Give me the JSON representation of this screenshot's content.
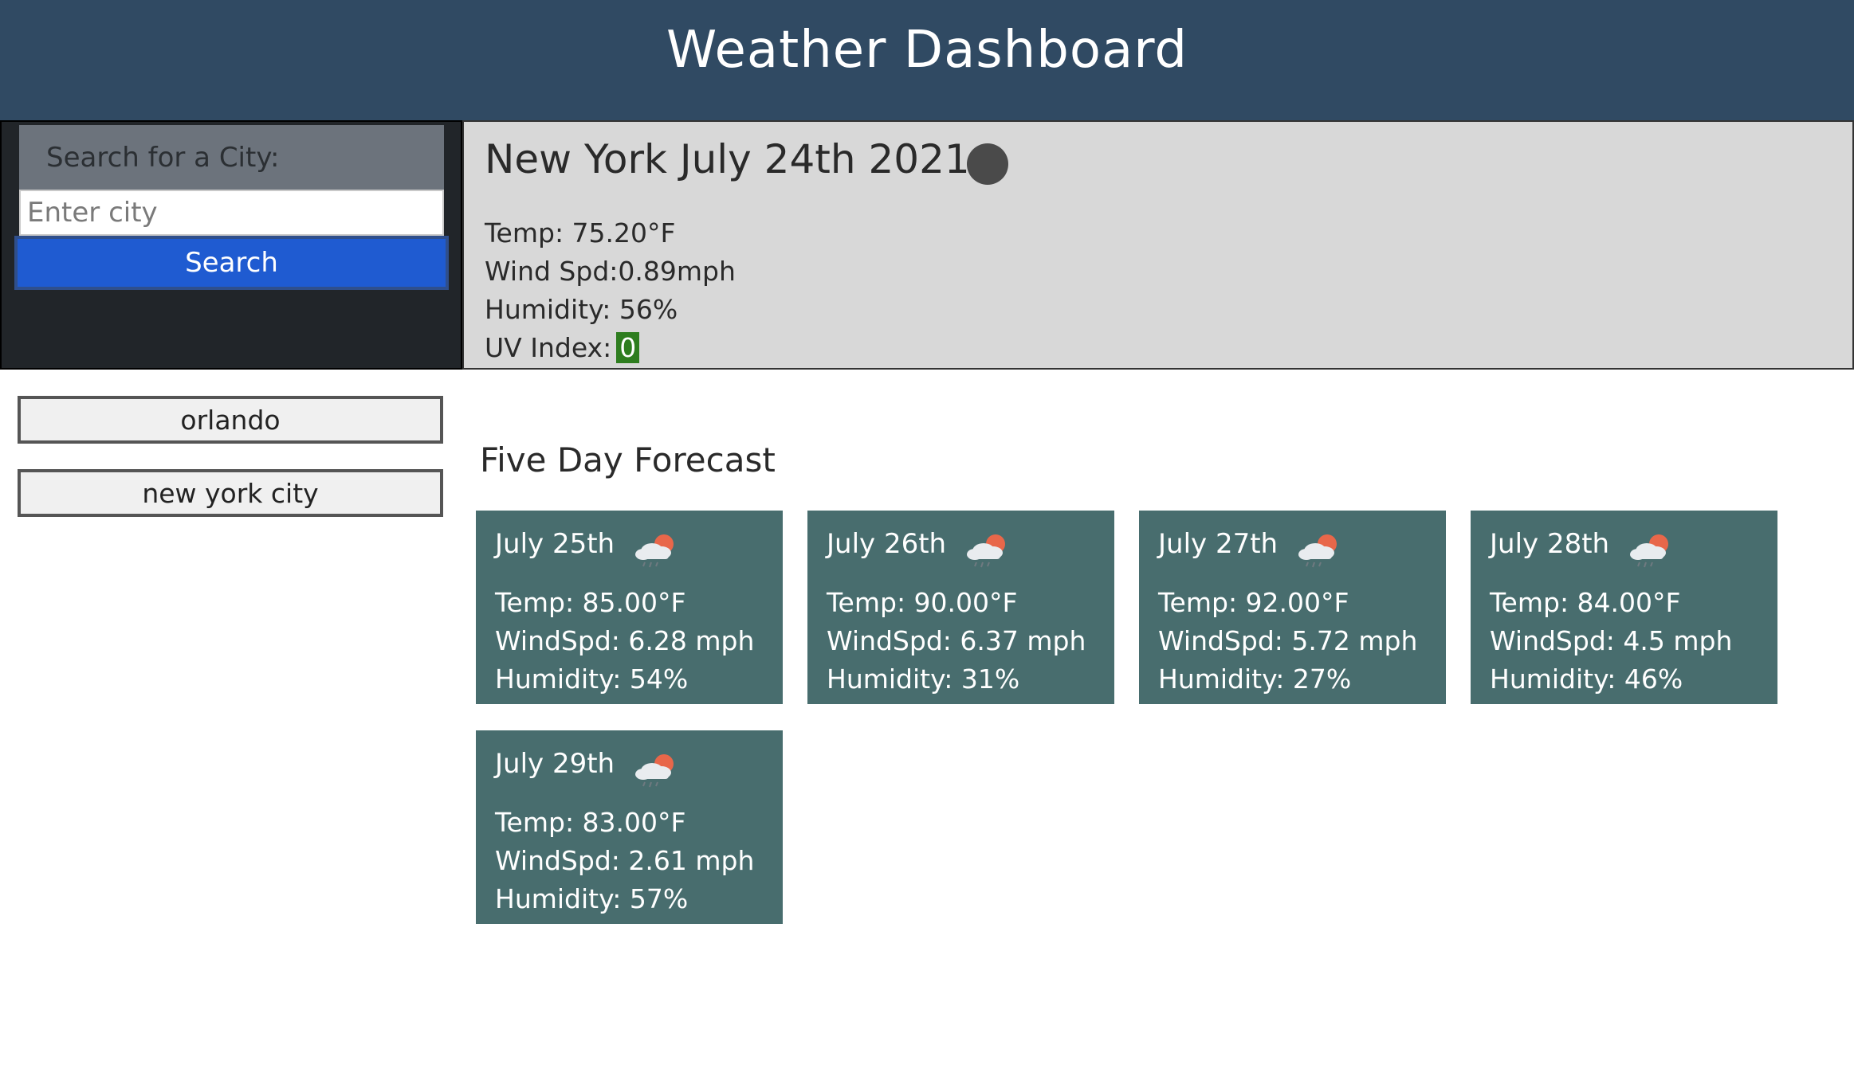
{
  "header": {
    "title": "Weather Dashboard"
  },
  "search": {
    "label": "Search for a City:",
    "placeholder": "Enter city",
    "value": "",
    "button_label": "Search"
  },
  "history": [
    {
      "label": "orlando"
    },
    {
      "label": "new york city"
    }
  ],
  "current": {
    "title": "New York July 24th 2021",
    "temp": "Temp: 75.20°F",
    "wind": "Wind Spd:0.89mph",
    "humidity": "Humidity: 56%",
    "uv_label": "UV Index:",
    "uv_value": "0",
    "uv_color": "#2e7d1f",
    "icon": "weather-icon"
  },
  "forecast": {
    "heading": "Five Day Forecast",
    "days": [
      {
        "date": "July 25th",
        "temp": "Temp: 85.00°F",
        "wind": "WindSpd: 6.28 mph",
        "humidity": "Humidity: 54%",
        "icon": "cloud-sun-rain-icon"
      },
      {
        "date": "July 26th",
        "temp": "Temp: 90.00°F",
        "wind": "WindSpd: 6.37 mph",
        "humidity": "Humidity: 31%",
        "icon": "cloud-sun-rain-icon"
      },
      {
        "date": "July 27th",
        "temp": "Temp: 92.00°F",
        "wind": "WindSpd: 5.72 mph",
        "humidity": "Humidity: 27%",
        "icon": "cloud-sun-rain-icon"
      },
      {
        "date": "July 28th",
        "temp": "Temp: 84.00°F",
        "wind": "WindSpd: 4.5 mph",
        "humidity": "Humidity: 46%",
        "icon": "cloud-sun-rain-icon"
      },
      {
        "date": "July 29th",
        "temp": "Temp: 83.00°F",
        "wind": "WindSpd: 2.61 mph",
        "humidity": "Humidity: 57%",
        "icon": "cloud-sun-rain-icon"
      }
    ]
  },
  "colors": {
    "header_bg": "#304a63",
    "card_bg": "#486d6e",
    "search_button": "#1f5bd1"
  }
}
